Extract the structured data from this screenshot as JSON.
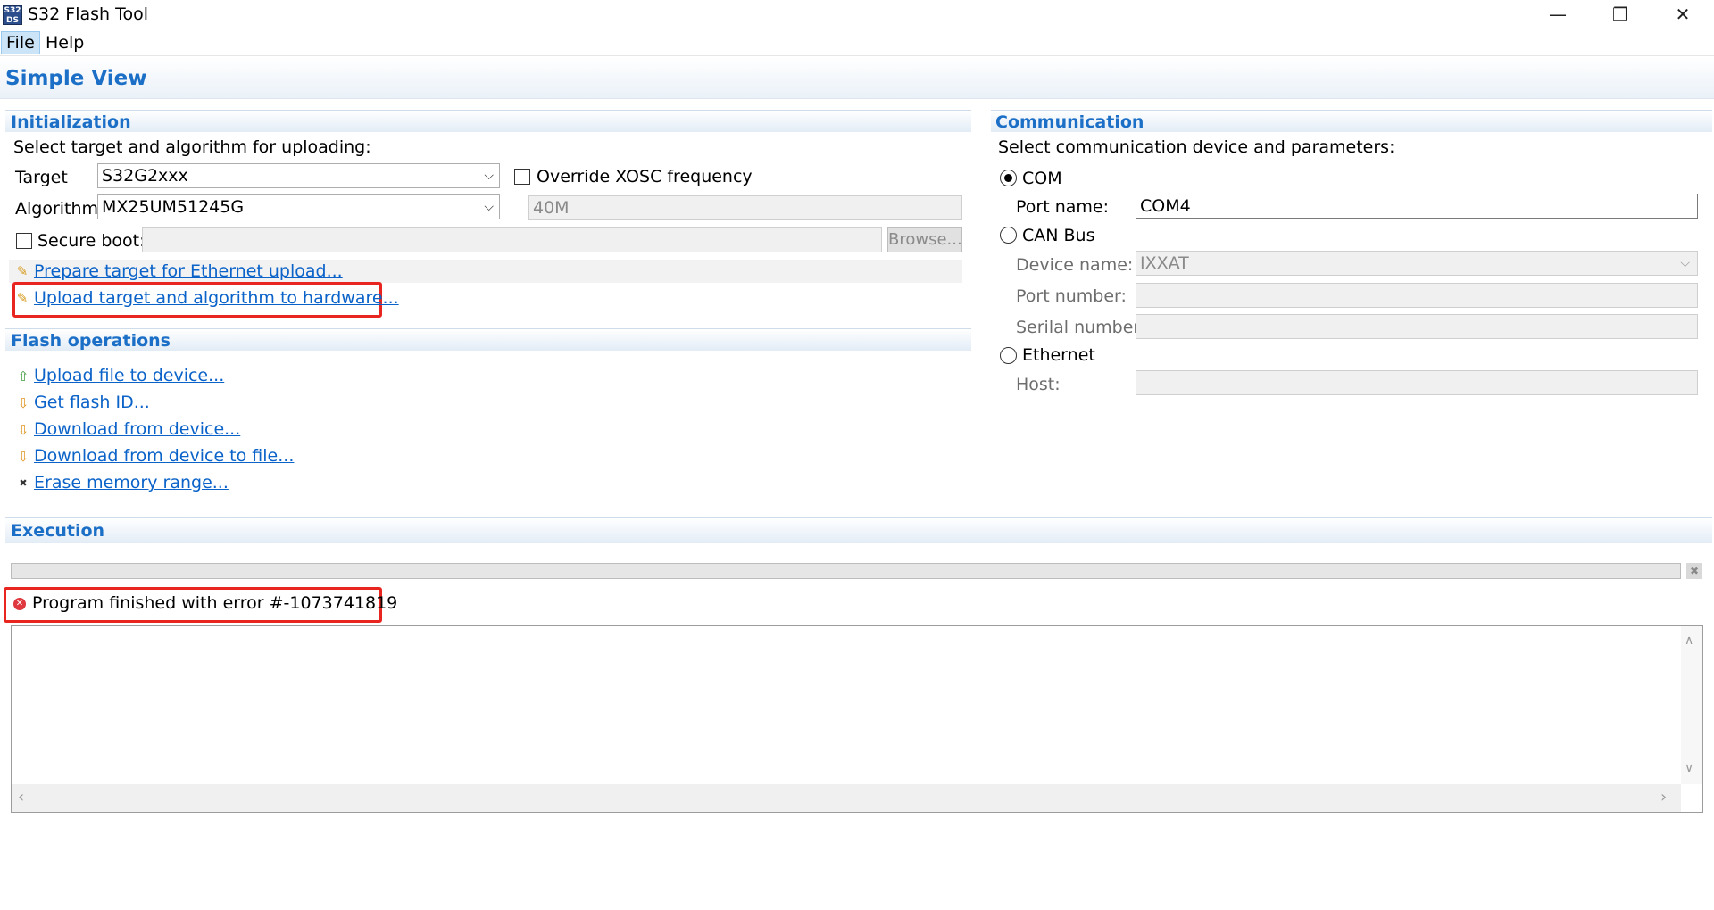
{
  "window": {
    "title": "S32 Flash Tool",
    "app_icon_text": "S32\nDS",
    "minimize_glyph": "—",
    "restore_glyph": "❐",
    "close_glyph": "✕"
  },
  "menu": {
    "file": "File",
    "help": "Help"
  },
  "view": {
    "title": "Simple View"
  },
  "initialization": {
    "header": "Initialization",
    "subtitle": "Select target and algorithm for uploading:",
    "target_label": "Target",
    "target_value": "S32G2xxx",
    "algorithm_label": "Algorithm",
    "algorithm_value": "MX25UM51245G",
    "override_xosc_label": "Override XOSC frequency",
    "xosc_value": "40M",
    "secure_boot_label": "Secure boot:",
    "browse_label": "Browse...",
    "prepare_link": "Prepare target for Ethernet upload...",
    "upload_link": "Upload target and algorithm to hardware..."
  },
  "flash_operations": {
    "header": "Flash operations",
    "items": [
      {
        "label": "Upload file to device...",
        "icon": "upload-arrow-icon"
      },
      {
        "label": "Get flash ID...",
        "icon": "download-arrow-icon"
      },
      {
        "label": "Download from device...",
        "icon": "download-arrow-icon"
      },
      {
        "label": "Download from device to file...",
        "icon": "download-arrow-icon"
      },
      {
        "label": "Erase memory range...",
        "icon": "erase-icon"
      }
    ]
  },
  "communication": {
    "header": "Communication",
    "subtitle": "Select communication device and parameters:",
    "com_label": "COM",
    "port_name_label": "Port name:",
    "port_name_value": "COM4",
    "can_label": "CAN Bus",
    "device_name_label": "Device name:",
    "device_name_value": "IXXAT",
    "port_number_label": "Port number:",
    "serial_number_label": "Serilal number:",
    "ethernet_label": "Ethernet",
    "host_label": "Host:"
  },
  "execution": {
    "header": "Execution",
    "status": "Program finished with error #-1073741819",
    "progress": 0
  },
  "colors": {
    "accent": "#1c6fc6",
    "link": "#0b63c9",
    "highlight": "#e8261f"
  }
}
